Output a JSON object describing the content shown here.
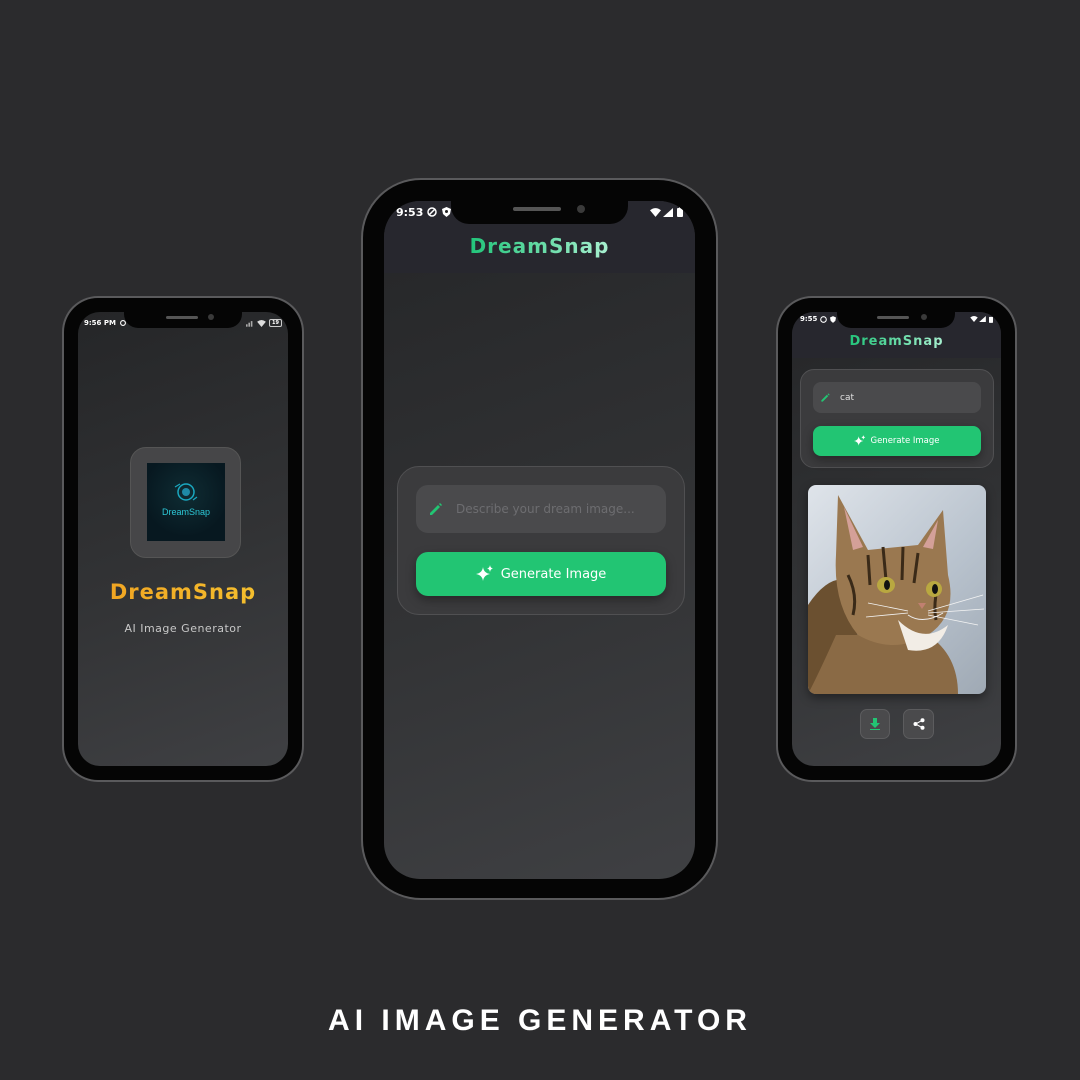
{
  "caption": "AI IMAGE GENERATOR",
  "colors": {
    "background": "#2b2b2d",
    "accent": "#22c573",
    "brand_orange": "#f0a020"
  },
  "left_phone": {
    "status": {
      "time": "9:56 PM",
      "battery": "19"
    },
    "logo_text": "DreamSnap",
    "app_name": "DreamSnap",
    "subtitle": "AI Image Generator"
  },
  "center_phone": {
    "status": {
      "time": "9:53"
    },
    "title": "DreamSnap",
    "prompt_placeholder": "Describe your dream image...",
    "generate_label": "Generate Image"
  },
  "right_phone": {
    "status": {
      "time": "9:55"
    },
    "title": "DreamSnap",
    "prompt_value": "cat",
    "generate_label": "Generate Image",
    "result_image": "tabby-cat-portrait",
    "icons": [
      "pencil-icon",
      "sparkle-icon",
      "download-icon",
      "share-icon"
    ]
  }
}
